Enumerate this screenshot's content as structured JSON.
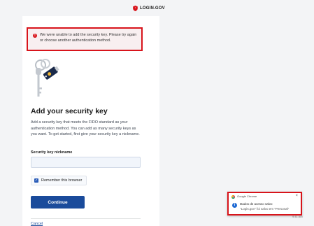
{
  "brand": {
    "name": "LOGIN.GOV",
    "accent_color": "#d8141b"
  },
  "alert": {
    "message": "We were unable to add the security key. Please try again or choose another authentication method."
  },
  "page": {
    "title": "Add your security key",
    "intro": "Add a security key that meets the FIDO standard as your authentication method. You can add as many security keys as you want. To get started, first give your security key a nickname."
  },
  "form": {
    "nickname_label": "Security key nickname",
    "nickname_value": "",
    "remember_label": "Remember this browser",
    "remember_checked": true,
    "continue_label": "Continue",
    "cancel_label": "Cancel"
  },
  "notification": {
    "app_name": "Google Chrome",
    "title": "Dados de acesso salvo",
    "body": "\"Login.gov\" foi salvo em \"Personal\"",
    "close_symbol": "×",
    "icon": "info-icon"
  },
  "taskbar": {
    "clock": "9:41 AM"
  },
  "colors": {
    "primary": "#1a4b9b",
    "error": "#d8141b",
    "background": "#f3f4f6"
  }
}
